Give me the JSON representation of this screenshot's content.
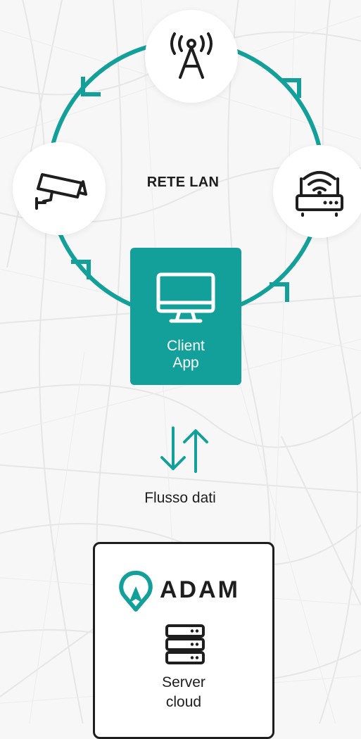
{
  "colors": {
    "accent": "#14a09a",
    "text": "#1e1e1e",
    "background": "#f7f7f7",
    "node_fill": "#ffffff"
  },
  "lan": {
    "label": "RETE LAN",
    "nodes": [
      {
        "id": "antenna",
        "icon": "antenna-tower-icon"
      },
      {
        "id": "router",
        "icon": "wifi-router-icon"
      },
      {
        "id": "camera",
        "icon": "security-camera-icon"
      }
    ],
    "ring_arrows": [
      "arrow-ccw",
      "arrow-ccw",
      "arrow-ccw",
      "arrow-ccw"
    ]
  },
  "client": {
    "label": "Client\nApp",
    "icon": "monitor-icon"
  },
  "flow": {
    "label": "Flusso dati",
    "icon": "bidirectional-arrows-icon"
  },
  "server": {
    "brand": "ADAM",
    "brand_icon": "adam-logo-icon",
    "icon": "server-stack-icon",
    "label": "Server\ncloud"
  }
}
